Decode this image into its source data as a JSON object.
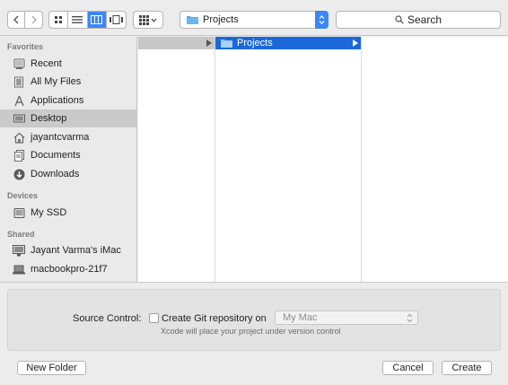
{
  "toolbar": {
    "icons": {
      "back": "chevron-left-icon",
      "forward": "chevron-right-icon",
      "icon_view": "grid-icon",
      "list_view": "list-icon",
      "column_view": "columns-icon",
      "coverflow_view": "coverflow-icon",
      "arrange": "arrange-grid-icon"
    },
    "path_popup": {
      "label": "Projects",
      "icon": "folder-icon"
    },
    "search": {
      "placeholder": "Search",
      "icon": "magnifier-icon"
    }
  },
  "sidebar": {
    "sections": [
      {
        "heading": "Favorites",
        "items": [
          {
            "label": "Recent",
            "icon": "recent-icon",
            "selected": false
          },
          {
            "label": "All My Files",
            "icon": "all-files-icon",
            "selected": false
          },
          {
            "label": "Applications",
            "icon": "applications-icon",
            "selected": false
          },
          {
            "label": "Desktop",
            "icon": "desktop-icon",
            "selected": true
          },
          {
            "label": "jayantcvarma",
            "icon": "home-icon",
            "selected": false
          },
          {
            "label": "Documents",
            "icon": "documents-icon",
            "selected": false
          },
          {
            "label": "Downloads",
            "icon": "downloads-icon",
            "selected": false
          }
        ]
      },
      {
        "heading": "Devices",
        "items": [
          {
            "label": "My SSD",
            "icon": "disk-icon",
            "selected": false
          }
        ]
      },
      {
        "heading": "Shared",
        "items": [
          {
            "label": "Jayant Varma's iMac",
            "icon": "imac-icon",
            "selected": false
          },
          {
            "label": "macbookpro-21f7",
            "icon": "macbook-icon",
            "selected": false
          }
        ]
      }
    ]
  },
  "browser": {
    "column2": {
      "item": "Projects",
      "icon": "folder-icon"
    }
  },
  "source_control": {
    "label": "Source Control:",
    "checkbox_label": "Create Git repository on",
    "checked": false,
    "location": "My Mac",
    "hint": "Xcode will place your project under version control"
  },
  "buttons": {
    "new_folder": "New Folder",
    "cancel": "Cancel",
    "create": "Create"
  },
  "colors": {
    "accent": "#3d86f6",
    "selection": "#1c68d8",
    "sidebar_selection": "#cacaca"
  }
}
